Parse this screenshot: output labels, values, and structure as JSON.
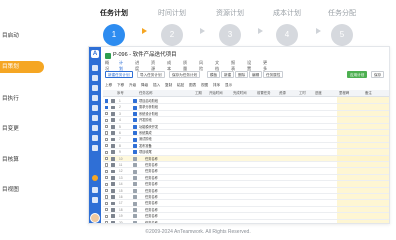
{
  "side_nav": {
    "items": [
      {
        "label": "目启动",
        "active": false
      },
      {
        "label": "目策划",
        "active": true
      },
      {
        "label": "目执行",
        "active": false
      },
      {
        "label": "目变更",
        "active": false
      },
      {
        "label": "目核算",
        "active": false
      },
      {
        "label": "目视图",
        "active": false
      }
    ]
  },
  "steps": [
    {
      "title": "任务计划",
      "num": "1",
      "active": true
    },
    {
      "title": "时间计划",
      "num": "2",
      "active": false
    },
    {
      "title": "资源计划",
      "num": "3",
      "active": false
    },
    {
      "title": "成本计划",
      "num": "4",
      "active": false
    },
    {
      "title": "任务分配",
      "num": "5",
      "active": false
    }
  ],
  "app": {
    "title": "P-096 - 软件产品迭代项目",
    "rail_logo": "A",
    "tabs": [
      "概况",
      "计划",
      "进度",
      "资源",
      "成本",
      "质量",
      "风险",
      "文档",
      "报表",
      "设置",
      "更多"
    ],
    "toolbar": {
      "buttons": [
        "新建任务计划",
        "导入任务计划",
        "保存为任务计划",
        "模板",
        "新建",
        "删除",
        "编辑",
        "任务属性"
      ],
      "right_button": "应用计划",
      "save_button": "保存"
    },
    "subtoolbar": [
      "上移",
      "下移",
      "升级",
      "降级",
      "插入",
      "复制",
      "粘贴",
      "图表",
      "视图",
      "排序",
      "显示"
    ],
    "columns": [
      "序号",
      "任务名称",
      "工期",
      "开始时间",
      "完成时间",
      "前置任务",
      "资源",
      "工时",
      "进度",
      "里程碑",
      "备注"
    ],
    "rows": [
      {
        "id": "1",
        "name": "项目启动阶段",
        "checked": true
      },
      {
        "id": "2",
        "name": "需求分析阶段",
        "checked": true
      },
      {
        "id": "3",
        "name": "系统设计阶段",
        "checked": false
      },
      {
        "id": "4",
        "name": "开发阶段",
        "checked": false
      },
      {
        "id": "5",
        "name": "功能模块开发",
        "checked": false
      },
      {
        "id": "6",
        "name": "系统集成",
        "checked": false
      },
      {
        "id": "7",
        "name": "测试阶段",
        "checked": false
      },
      {
        "id": "8",
        "name": "发布准备",
        "checked": false
      },
      {
        "id": "9",
        "name": "项目收尾",
        "checked": false
      },
      {
        "id": "10",
        "name": "任务名称",
        "checked": false,
        "highlight": true
      },
      {
        "id": "11",
        "name": "任务名称",
        "checked": false
      },
      {
        "id": "12",
        "name": "任务名称",
        "checked": false
      },
      {
        "id": "13",
        "name": "任务名称",
        "checked": false
      },
      {
        "id": "14",
        "name": "任务名称",
        "checked": false
      },
      {
        "id": "15",
        "name": "任务名称",
        "checked": false
      },
      {
        "id": "16",
        "name": "任务名称",
        "checked": false
      },
      {
        "id": "17",
        "name": "任务名称",
        "checked": false
      },
      {
        "id": "18",
        "name": "任务名称",
        "checked": false
      },
      {
        "id": "19",
        "name": "任务名称",
        "checked": false
      },
      {
        "id": "20",
        "name": "任务名称",
        "checked": false
      }
    ]
  },
  "footer": "©2009-2024 AnTeamwork. All Rights Reserved."
}
